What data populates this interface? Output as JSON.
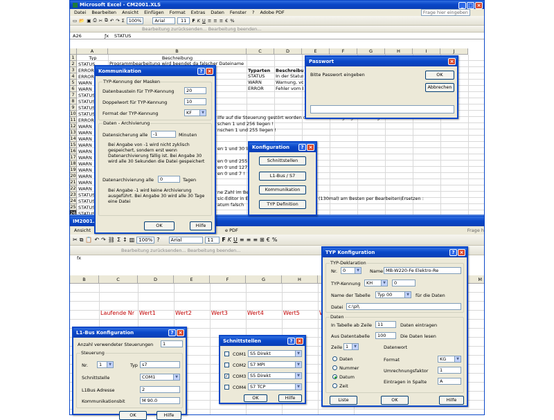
{
  "top_window": {
    "title": "Microsoft Excel - CM2001.XLS",
    "menu": [
      "Datei",
      "Bearbeiten",
      "Ansicht",
      "Einfügen",
      "Format",
      "Extras",
      "Daten",
      "Fenster",
      "?",
      "Adobe PDF"
    ],
    "help_placeholder": "Frage hier eingeben",
    "toolbar_text": "Bearbeitung zurücksenden...  Bearbeitung beenden...",
    "zoom": "100%",
    "font": "Arial",
    "font_size": "11",
    "cell_ref": "A26",
    "formula": "STATUS",
    "columns": [
      "A",
      "B",
      "C",
      "D",
      "E",
      "F",
      "G",
      "H",
      "I",
      "J"
    ],
    "rows": [
      "1",
      "2",
      "3",
      "4",
      "5",
      "6",
      "7",
      "8",
      "9",
      "10",
      "11",
      "12",
      "13",
      "14",
      "15",
      "16",
      "17",
      "18",
      "19",
      "20",
      "21",
      "22",
      "23",
      "24",
      "25",
      "26"
    ],
    "colA": [
      "Typ",
      "STATUS",
      "ERROR",
      "ERROR",
      "WARN",
      "WARN",
      "STATUS",
      "STATUS",
      "STATUS",
      "STATUS",
      "ERROR",
      "WARN",
      "WARN",
      "WARN",
      "WARN",
      "WARN",
      "WARN",
      "WARN",
      "WARN",
      "WARN",
      "WARN",
      "WARN",
      "STATUS",
      "STATUS",
      "STATUS",
      "STATUS"
    ],
    "b1": "Beschreibung",
    "b2": "Programmbearbeitung wird beendet da falscher Dateiname",
    "c1_5": [
      "Typarten",
      "STATUS",
      "WARN",
      "ERROR"
    ],
    "d1_5": [
      "Beschreibung",
      "In der Statuszeile",
      "Warnung, vor",
      "Fehler vom Betr"
    ],
    "b11": "ilfe auf die Steuerung gestört worden oder die Berechtigungsstufen abgelaufen",
    "b12": "schen 1 und 256 liegen !",
    "b13": "nschen 1 und 255 liegen !",
    "b16": "en 1 und 30 lie",
    "b18": "en 0 und 255 l",
    "b19": "en 0 und 127 l",
    "b20": "en 0 und 7 !",
    "b23": "ne Zahl im Bere",
    "b24": "sic-Editor in Exc",
    "b25": "atum falsch",
    "h24": "ndern (130mal) am Besten per Bearbeiten\\Ersetzen :"
  },
  "bottom_window": {
    "title": "IM2001.XLS",
    "menu_first": "Ansicht",
    "menu_last": "e PDF",
    "page_label": "Frage h",
    "zoom": "100%",
    "font": "Arial",
    "font_size": "11",
    "toolbar_text": "Bearbeitung zurücksenden...  Bearbeitung beenden...",
    "fx": "fx",
    "columns": [
      "B",
      "C",
      "D",
      "E",
      "F",
      "G",
      "H",
      "I",
      "M"
    ],
    "headers": [
      "Laufende Nr",
      "Wert1",
      "Wert2",
      "Wert3",
      "Wert4",
      "Wert5",
      "W"
    ]
  },
  "kommunikation": {
    "title": "Kommunikation",
    "group1": "TYP-Kennung der Masken",
    "db_label": "Datenbaustein für TYP-Kennung",
    "db_value": "20",
    "dw_label": "Doppelwort für TYP-Kennung",
    "dw_value": "10",
    "fmt_label": "Format der TYP-Kennung",
    "fmt_value": "KF",
    "group2": "Daten - Archivierung",
    "save_label": "Datensicherung alle",
    "save_value": "-1",
    "save_unit": "Minuten",
    "note1": "Bei Angabe von -1 wird nicht zyklisch gespeichert, sondern erst wenn Datenarchivierung fällig ist. Bei Angabe 30 wird alle 30 Sekunden die Datei gespeichert",
    "arch_label": "Datenarchivierung alle",
    "arch_value": "0",
    "arch_unit": "Tagen",
    "note2": "Bei Angabe -1 wird keine Archivierung ausgeführt. Bei Angabe 30 wird alle 30 Tage eine Datei",
    "ok": "OK",
    "help": "Hilfe"
  },
  "passwort": {
    "title": "Passwort",
    "prompt": "Bitte Passwort eingeben",
    "ok": "OK",
    "cancel": "Abbrechen"
  },
  "konfiguration": {
    "title": "Konfiguration",
    "b1": "Schnittstellen",
    "b2": "L1-Bus  /  S7",
    "b3": "Kommunikation",
    "b4": "TYP Definition"
  },
  "l1bus": {
    "title": "L1-Bus Konfiguration",
    "count_label": "Anzahl verwendeter Steuerungen",
    "count_value": "1",
    "group": "Steuerung",
    "nr_label": "Nr.",
    "nr_value": "1",
    "typ_label": "Typ",
    "typ_value": "s7",
    "port_label": "Schnittstelle",
    "port_value": "COM1",
    "addr_label": "L1Bus Adresse",
    "addr_value": "2",
    "bit_label": "Kommunikationsbit",
    "bit_value": "M 90.0",
    "ok": "OK",
    "help": "Hilfe"
  },
  "schnittstellen": {
    "title": "Schnittstellen",
    "ports": [
      {
        "name": "COM1",
        "value": "S5 Direkt",
        "checked": false
      },
      {
        "name": "COM2",
        "value": "S7 MPI",
        "checked": false
      },
      {
        "name": "COM3",
        "value": "S5 Direkt",
        "checked": true
      },
      {
        "name": "COM4",
        "value": "S7 TCP",
        "checked": false
      }
    ],
    "ok": "OK",
    "help": "Hilfe"
  },
  "typkonf": {
    "title": "TYP Konfiguration",
    "group1": "TYP-Deklaration",
    "nr_label": "Nr.",
    "nr_value": "0",
    "name_label": "Name",
    "name_value": "MB-W220-Fe Elektro-Re",
    "kennung_label": "TYP-Kennung",
    "kennung_fmt": "KH",
    "kennung_value": "0",
    "table_label": "Name der Tabelle",
    "table_value": "Typ 00",
    "table_suffix": "für die Daten",
    "file_label": "Datei",
    "file_value": "c:\\pl\\",
    "group2": "Daten",
    "row_label": "In Tabelle ab Zeile",
    "row_value": "11",
    "row_suffix": "Daten eintragen",
    "from_label": "Aus Datentabelle",
    "from_value": "100",
    "from_suffix": "Die Daten lesen",
    "zeile_label": "Zeile",
    "zeile_value": "1",
    "datenwort": "Datenwort",
    "radios": [
      {
        "label": "Daten",
        "on": false
      },
      {
        "label": "Nummer",
        "on": false
      },
      {
        "label": "Datum",
        "on": true
      },
      {
        "label": "Zeit",
        "on": false
      }
    ],
    "format_label": "Format",
    "format_value": "KG",
    "factor_label": "Umrechnungsfaktor",
    "factor_value": "1",
    "col_label": "Eintragen in Spalte",
    "col_value": "A",
    "list": "Liste",
    "ok": "OK",
    "help": "Hilfe"
  }
}
